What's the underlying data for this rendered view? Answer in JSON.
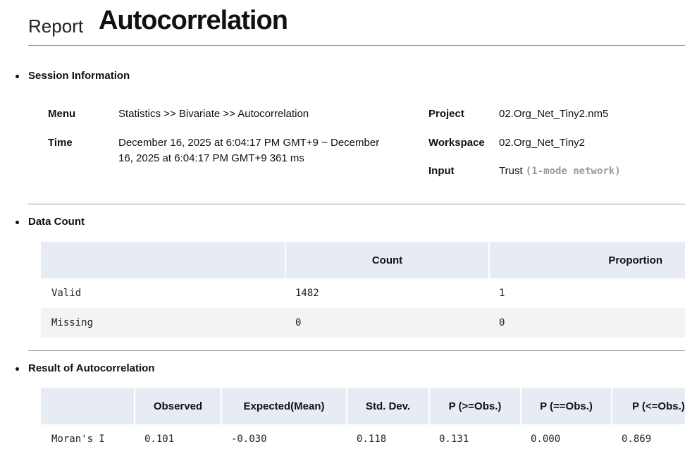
{
  "header": {
    "label": "Report",
    "title": "Autocorrelation"
  },
  "session": {
    "title": "Session Information",
    "menu_key": "Menu",
    "menu_value": "Statistics >> Bivariate >> Autocorrelation",
    "time_key": "Time",
    "time_value": "December 16, 2025 at 6:04:17 PM GMT+9 ~ December 16, 2025 at 6:04:17 PM GMT+9 361 ms",
    "project_key": "Project",
    "project_value": "02.Org_Net_Tiny2.nm5",
    "workspace_key": "Workspace",
    "workspace_value": "02.Org_Net_Tiny2",
    "input_key": "Input",
    "input_value": "Trust",
    "input_type": "(1-mode network)"
  },
  "data_count": {
    "title": "Data Count",
    "headers": [
      "",
      "Count",
      "Proportion"
    ],
    "rows": [
      [
        "Valid",
        "1482",
        "1"
      ],
      [
        "Missing",
        "0",
        "0"
      ]
    ]
  },
  "result": {
    "title": "Result of Autocorrelation",
    "headers": [
      "",
      "Observed",
      "Expected(Mean)",
      "Std. Dev.",
      "P (>=Obs.)",
      "P (==Obs.)",
      "P (<=Obs.)"
    ],
    "rows": [
      [
        "Moran's I",
        "0.101",
        "-0.030",
        "0.118",
        "0.131",
        "0.000",
        "0.869"
      ]
    ]
  }
}
